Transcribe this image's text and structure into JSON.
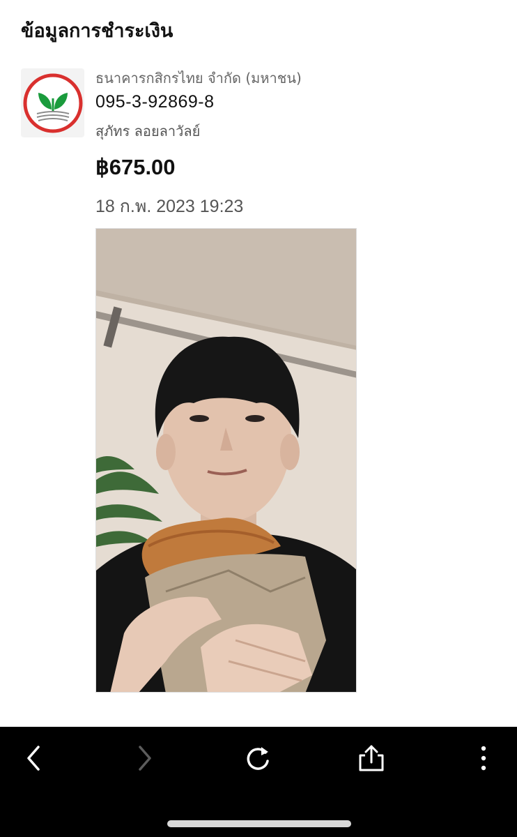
{
  "header": {
    "title": "ข้อมูลการชำระเงิน"
  },
  "payment": {
    "bank_name": "ธนาคารกสิกรไทย จำกัด (มหาชน)",
    "bank_logo_icon": "kasikorn-bank-logo",
    "account_number": "095-3-92869-8",
    "account_name": "สุภัทร ลอยลาวัลย์",
    "amount": "฿675.00",
    "datetime": "18 ก.พ. 2023 19:23"
  },
  "attachment": {
    "type": "photo",
    "description_icon": "photo-selfie"
  },
  "toolbar": {
    "back_icon": "chevron-left-icon",
    "forward_icon": "chevron-right-icon",
    "reload_icon": "reload-icon",
    "share_icon": "share-icon",
    "more_icon": "more-vertical-icon"
  },
  "colors": {
    "kbank_green": "#1a9b3c",
    "kbank_red": "#d9302e",
    "toolbar_bg": "#000000"
  }
}
